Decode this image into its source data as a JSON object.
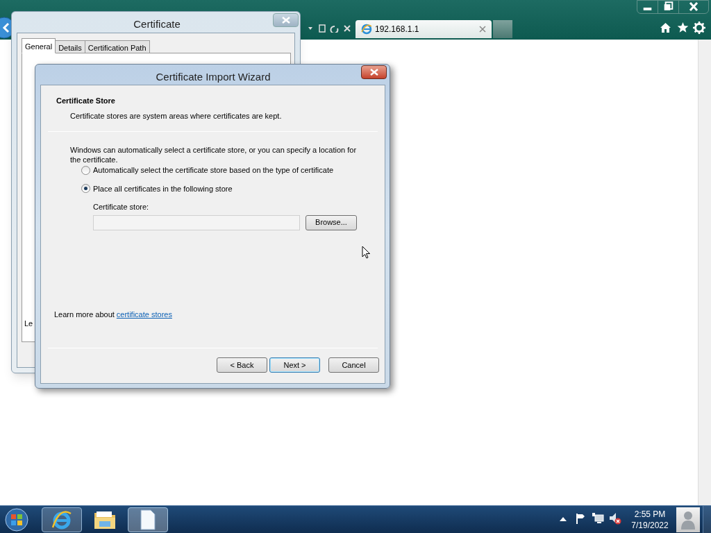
{
  "browser": {
    "tabs": [
      {
        "label": "192.168.1.1",
        "selected": true
      }
    ]
  },
  "certificate_dialog": {
    "title": "Certificate",
    "tabs": [
      {
        "label": "General",
        "selected": true
      },
      {
        "label": "Details",
        "selected": false
      },
      {
        "label": "Certification Path",
        "selected": false
      }
    ],
    "partial_text": "Le"
  },
  "wizard": {
    "title": "Certificate Import Wizard",
    "heading": "Certificate Store",
    "subheading": "Certificate stores are system areas where certificates are kept.",
    "intro": "Windows can automatically select a certificate store, or you can specify a location for the certificate.",
    "options": [
      {
        "label": "Automatically select the certificate store based on the type of certificate",
        "selected": false
      },
      {
        "label": "Place all certificates in the following store",
        "selected": true
      }
    ],
    "store_label": "Certificate store:",
    "browse_button": "Browse...",
    "learn_more": "Learn more about",
    "learn_more_link": "certificate stores",
    "buttons": [
      {
        "label": "< Back",
        "kind": "normal"
      },
      {
        "label": "Next >",
        "kind": "default"
      },
      {
        "label": "Cancel",
        "kind": "normal"
      }
    ]
  },
  "taskbar": {
    "time": "2:55 PM",
    "date": "7/19/2022"
  }
}
